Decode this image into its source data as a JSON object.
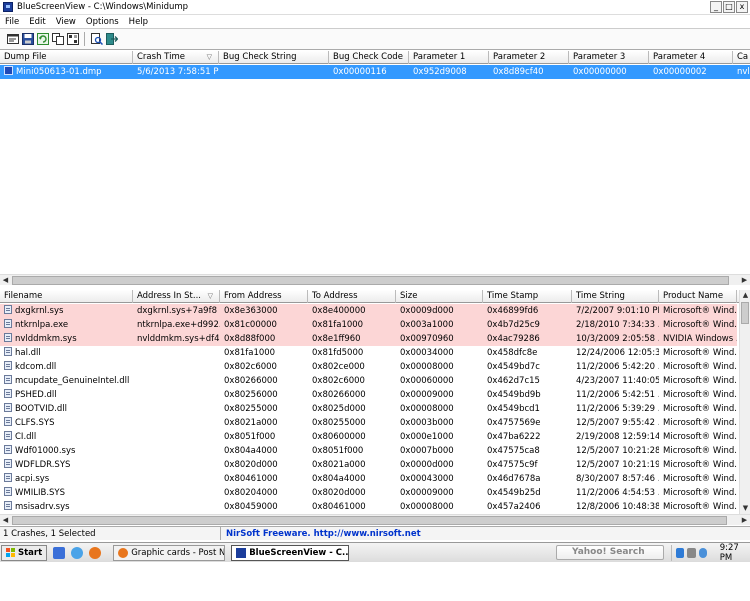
{
  "window": {
    "title": "BlueScreenView  -  C:\\Windows\\Minidump",
    "minimize": "_",
    "maximize": "□",
    "close": "x"
  },
  "menu": [
    "File",
    "Edit",
    "View",
    "Options",
    "Help"
  ],
  "toolbar_icons": [
    "properties-icon",
    "save-icon",
    "refresh-icon",
    "copy-icon",
    "options-icon",
    "find-icon",
    "exit-icon"
  ],
  "dumps": {
    "columns": [
      "Dump File",
      "Crash Time",
      "Bug Check String",
      "Bug Check Code",
      "Parameter 1",
      "Parameter 2",
      "Parameter 3",
      "Parameter 4",
      "Ca"
    ],
    "sort_indicator": "▽",
    "rows": [
      [
        "Mini050613-01.dmp",
        "5/6/2013 7:58:51 PM",
        "",
        "0x00000116",
        "0x952d9008",
        "0x8d89cf40",
        "0x00000000",
        "0x00000002",
        "nvl"
      ]
    ]
  },
  "drivers": {
    "columns": [
      "Filename",
      "Address In St...",
      "From Address",
      "To Address",
      "Size",
      "Time Stamp",
      "Time String",
      "Product Name",
      "F"
    ],
    "sort_indicator": "▽",
    "rows": [
      [
        "dxgkrnl.sys",
        "dxgkrnl.sys+7a9f8",
        "0x8e363000",
        "0x8e400000",
        "0x0009d000",
        "0x46899fd6",
        "7/2/2007 9:01:10 PM",
        "Microsoft® Wind..."
      ],
      [
        "ntkrnlpa.exe",
        "ntkrnlpa.exe+d992...",
        "0x81c00000",
        "0x81fa1000",
        "0x003a1000",
        "0x4b7d25c9",
        "2/18/2010 7:34:33 ...",
        "Microsoft® Wind..."
      ],
      [
        "nvlddmkm.sys",
        "nvlddmkm.sys+df40",
        "0x8d88f000",
        "0x8e1ff960",
        "0x00970960",
        "0x4ac79286",
        "10/3/2009 2:05:58 ...",
        "NVIDIA Windows ..."
      ],
      [
        "hal.dll",
        "",
        "0x81fa1000",
        "0x81fd5000",
        "0x00034000",
        "0x458dfc8e",
        "12/24/2006 12:05:3...",
        "Microsoft® Wind..."
      ],
      [
        "kdcom.dll",
        "",
        "0x802c6000",
        "0x802ce000",
        "0x00008000",
        "0x4549bd7c",
        "11/2/2006 5:42:20 ...",
        "Microsoft® Wind..."
      ],
      [
        "mcupdate_GenuineIntel.dll",
        "",
        "0x80266000",
        "0x802c6000",
        "0x00060000",
        "0x462d7c15",
        "4/23/2007 11:40:05...",
        "Microsoft® Wind..."
      ],
      [
        "PSHED.dll",
        "",
        "0x80256000",
        "0x80266000",
        "0x00009000",
        "0x4549bd9b",
        "11/2/2006 5:42:51 ...",
        "Microsoft® Wind..."
      ],
      [
        "BOOTVID.dll",
        "",
        "0x80255000",
        "0x8025d000",
        "0x00008000",
        "0x4549bcd1",
        "11/2/2006 5:39:29 ...",
        "Microsoft® Wind..."
      ],
      [
        "CLFS.SYS",
        "",
        "0x8021a000",
        "0x80255000",
        "0x0003b000",
        "0x4757569e",
        "12/5/2007 9:55:42 ...",
        "Microsoft® Wind..."
      ],
      [
        "CI.dll",
        "",
        "0x8051f000",
        "0x80600000",
        "0x000e1000",
        "0x47ba6222",
        "2/19/2008 12:59:14...",
        "Microsoft® Wind..."
      ],
      [
        "Wdf01000.sys",
        "",
        "0x804a4000",
        "0x8051f000",
        "0x0007b000",
        "0x47575ca8",
        "12/5/2007 10:21:28...",
        "Microsoft® Wind..."
      ],
      [
        "WDFLDR.SYS",
        "",
        "0x8020d000",
        "0x8021a000",
        "0x0000d000",
        "0x47575c9f",
        "12/5/2007 10:21:19...",
        "Microsoft® Wind..."
      ],
      [
        "acpi.sys",
        "",
        "0x80461000",
        "0x804a4000",
        "0x00043000",
        "0x46d7678a",
        "8/30/2007 8:57:46 ...",
        "Microsoft® Wind..."
      ],
      [
        "WMILIB.SYS",
        "",
        "0x80204000",
        "0x8020d000",
        "0x00009000",
        "0x4549b25d",
        "11/2/2006 4:54:53 ...",
        "Microsoft® Wind..."
      ],
      [
        "msisadrv.sys",
        "",
        "0x80459000",
        "0x80461000",
        "0x00008000",
        "0x457a2406",
        "12/8/2006 10:48:38...",
        "Microsoft® Wind..."
      ]
    ]
  },
  "status": {
    "crashes": "1 Crashes, 1 Selected",
    "freeware": "NirSoft Freeware.  http://www.nirsoft.net"
  },
  "taskbar": {
    "start": "Start",
    "tasks": [
      {
        "label": "Graphic cards - Post N...",
        "active": false
      },
      {
        "label": "BlueScreenView  -  C...",
        "active": true
      }
    ],
    "search_placeholder": "Yahoo! Search",
    "clock": "9:27 PM"
  },
  "colors": {
    "selection": "#3399ff",
    "highlight_row": "#fcd6d6",
    "link": "#0033cc"
  }
}
